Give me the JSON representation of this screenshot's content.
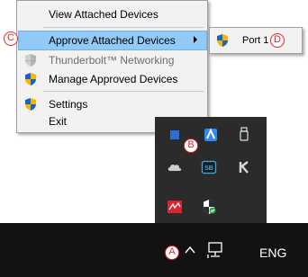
{
  "menu": {
    "items": [
      {
        "label": "View Attached Devices",
        "icon": "none",
        "enabled": true
      },
      {
        "label": "Approve Attached Devices",
        "icon": "none",
        "enabled": true,
        "selected": true,
        "has_submenu": true
      },
      {
        "label": "Thunderbolt™ Networking",
        "icon": "uac-shield-icon",
        "enabled": false
      },
      {
        "label": "Manage Approved Devices",
        "icon": "uac-shield-icon",
        "enabled": true
      },
      {
        "label": "Settings",
        "icon": "uac-shield-icon",
        "enabled": true
      },
      {
        "label": "Exit",
        "icon": "none",
        "enabled": true
      }
    ]
  },
  "submenu": {
    "items": [
      {
        "label": "Port 1",
        "icon": "uac-shield-icon"
      }
    ]
  },
  "taskbar": {
    "language": "ENG"
  },
  "callouts": {
    "a": "A",
    "b": "B",
    "c": "C",
    "d": "D"
  },
  "colors": {
    "menu_bg": "#f2f2f2",
    "menu_selected": "#91c9f7",
    "tray_bg": "#2b2b2b",
    "taskbar_bg": "#121212",
    "callout": "#e8232a"
  }
}
